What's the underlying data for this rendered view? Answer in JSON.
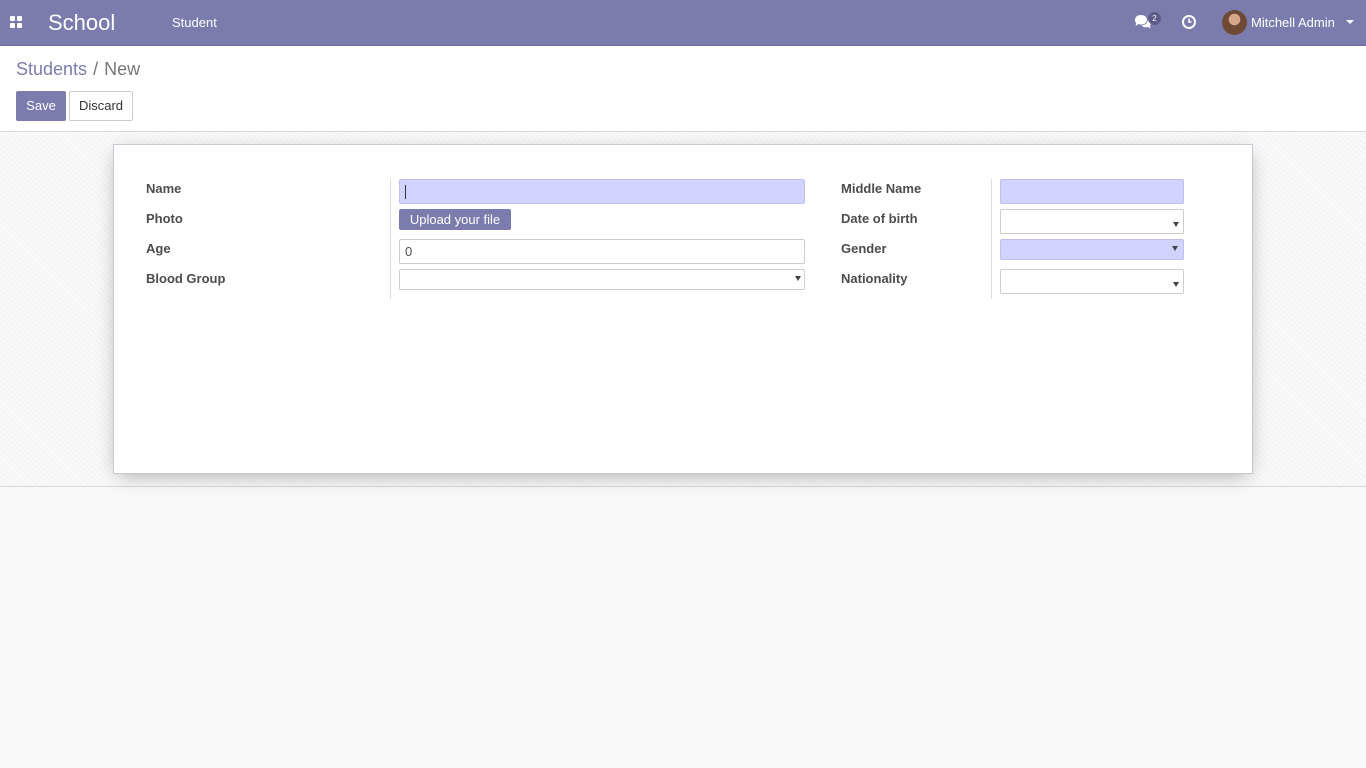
{
  "navbar": {
    "brand": "School",
    "menu": [
      {
        "label": "Student"
      }
    ],
    "chat_badge": "2",
    "user_name": "Mitchell Admin",
    "accent": "#7c7bad"
  },
  "breadcrumb": {
    "parent": "Students",
    "separator": "/",
    "current": "New"
  },
  "buttons": {
    "save": "Save",
    "discard": "Discard"
  },
  "form": {
    "left": [
      {
        "label": "Name",
        "value": ""
      },
      {
        "label": "Photo",
        "action": "Upload your file"
      },
      {
        "label": "Age",
        "value": "0"
      },
      {
        "label": "Blood Group",
        "value": ""
      }
    ],
    "right": [
      {
        "label": "Middle Name",
        "value": ""
      },
      {
        "label": "Date of birth",
        "value": ""
      },
      {
        "label": "Gender",
        "value": ""
      },
      {
        "label": "Nationality",
        "value": ""
      }
    ],
    "required_color": "#d2d2ff"
  },
  "icons": [
    "apps-icon",
    "chat-icon",
    "clock-icon",
    "caret-down-icon"
  ]
}
